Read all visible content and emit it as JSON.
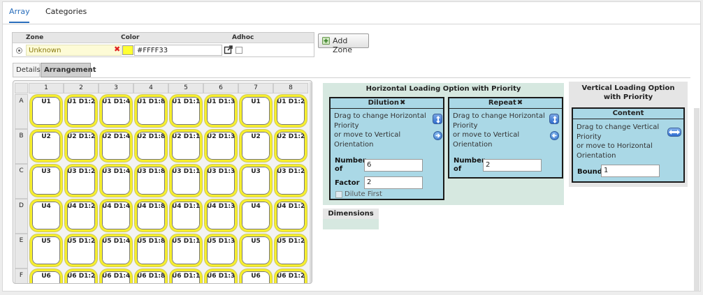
{
  "tabs": [
    {
      "label": "Array"
    },
    {
      "label": "Categories"
    }
  ],
  "zone_table": {
    "headers": {
      "zone": "Zone",
      "color": "Color",
      "adhoc": "Adhoc"
    },
    "row": {
      "zone": "Unknown",
      "color_value": "#FFFF33",
      "color_swatch": "#ffff33",
      "adhoc_checked": false
    }
  },
  "add_zone_label": "Add Zone",
  "sub_tabs": [
    {
      "label": "Details"
    },
    {
      "label": "Arrangement"
    }
  ],
  "grid": {
    "columns": [
      "1",
      "2",
      "3",
      "4",
      "5",
      "6",
      "7",
      "8"
    ],
    "rows": [
      {
        "label": "A",
        "wells": [
          "U1",
          "U1 D1:2",
          "U1 D1:4",
          "U1 D1:8",
          "U1 D1:16",
          "U1 D1:32",
          "U1",
          "U1 D1:2"
        ]
      },
      {
        "label": "B",
        "wells": [
          "U2",
          "U2 D1:2",
          "U2 D1:4",
          "U2 D1:8",
          "U2 D1:16",
          "U2 D1:32",
          "U2",
          "U2 D1:2"
        ]
      },
      {
        "label": "C",
        "wells": [
          "U3",
          "U3 D1:2",
          "U3 D1:4",
          "U3 D1:8",
          "U3 D1:16",
          "U3 D1:32",
          "U3",
          "U3 D1:2"
        ]
      },
      {
        "label": "D",
        "wells": [
          "U4",
          "U4 D1:2",
          "U4 D1:4",
          "U4 D1:8",
          "U4 D1:16",
          "U4 D1:32",
          "U4",
          "U4 D1:2"
        ]
      },
      {
        "label": "E",
        "wells": [
          "U5",
          "U5 D1:2",
          "U5 D1:4",
          "U5 D1:8",
          "U5 D1:16",
          "U5 D1:32",
          "U5",
          "U5 D1:2"
        ]
      },
      {
        "label": "F",
        "wells": [
          "U6",
          "U6 D1:2",
          "U6 D1:4",
          "U6 D1:8",
          "U6 D1:16",
          "U6 D1:32",
          "U6",
          "U6 D1:2"
        ]
      }
    ]
  },
  "horizontal": {
    "title": "Horizontal Loading Option with Priority",
    "dilution": {
      "title": "Dilution",
      "close": "✖",
      "text": [
        "Drag to change Horizontal",
        "Priority",
        "or move to Vertical",
        "Orientation"
      ],
      "number_of_label_1": "Number",
      "number_of_label_2": "of",
      "number_of_value": "6",
      "factor_label": "Factor",
      "factor_value": "2",
      "dilute_first_label": "Dilute First"
    },
    "repeat": {
      "title": "Repeat",
      "close": "✖",
      "text": [
        "Drag to change Horizontal",
        "Priority",
        "or move to Vertical",
        "Orientation"
      ],
      "number_of_label_1": "Number",
      "number_of_label_2": "of",
      "number_of_value": "2"
    }
  },
  "dimensions_label": "Dimensions",
  "vertical": {
    "title_1": "Vertical Loading Option",
    "title_2": "with Priority",
    "content": {
      "title": "Content",
      "text": [
        "Drag to change Vertical",
        "Priority",
        "or move to Horizontal",
        "Orientation"
      ],
      "bound_label": "Bound",
      "bound_value": "1"
    }
  }
}
